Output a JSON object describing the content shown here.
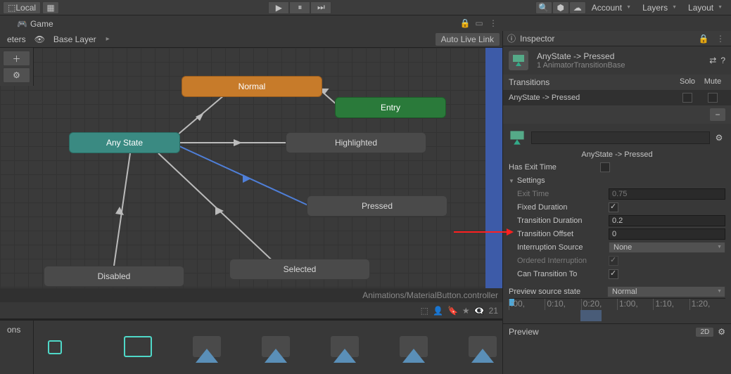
{
  "toolbar": {
    "local": "Local"
  },
  "dropdowns": {
    "account": "Account",
    "layers": "Layers",
    "layout": "Layout"
  },
  "tabs": {
    "game": "Game",
    "inspector": "Inspector"
  },
  "animator": {
    "left_tab_partial": "eters",
    "layer": "Base Layer",
    "autolink": "Auto Live Link",
    "footer": "Animations/MaterialButton.controller",
    "visible_count": "21"
  },
  "nodes": {
    "normal": "Normal",
    "entry": "Entry",
    "anystate": "Any State",
    "highlighted": "Highlighted",
    "pressed": "Pressed",
    "selected": "Selected",
    "disabled": "Disabled"
  },
  "inspector": {
    "title": "AnyState -> Pressed",
    "subtitle": "1 AnimatorTransitionBase",
    "transitions_header": "Transitions",
    "solo": "Solo",
    "mute": "Mute",
    "transition_item": "AnyState -> Pressed",
    "bar_label": "AnyState -> Pressed",
    "has_exit_time": "Has Exit Time",
    "settings": "Settings",
    "exit_time": "Exit Time",
    "exit_time_val": "0.75",
    "fixed_duration": "Fixed Duration",
    "transition_duration": "Transition Duration",
    "transition_duration_val": "0.2",
    "transition_offset": "Transition Offset",
    "transition_offset_val": "0",
    "interruption_source": "Interruption Source",
    "interruption_source_val": "None",
    "ordered_interruption": "Ordered Interruption",
    "can_transition_to": "Can Transition To ",
    "preview_source": "Preview source state",
    "preview_source_val": "Normal",
    "preview": "Preview"
  },
  "timeline": {
    "ticks": [
      ":00,",
      "0:10,",
      "0:20,",
      "1:00,",
      "1:10,",
      "1:20,"
    ]
  },
  "bottom": {
    "tab": "ons"
  },
  "chart_data": {
    "type": "graph",
    "nodes": [
      {
        "id": "Normal",
        "kind": "default-state",
        "color": "orange"
      },
      {
        "id": "Entry",
        "kind": "entry",
        "color": "green"
      },
      {
        "id": "Any State",
        "kind": "anystate",
        "color": "teal"
      },
      {
        "id": "Highlighted",
        "kind": "state",
        "color": "gray"
      },
      {
        "id": "Pressed",
        "kind": "state",
        "color": "gray"
      },
      {
        "id": "Selected",
        "kind": "state",
        "color": "gray"
      },
      {
        "id": "Disabled",
        "kind": "state",
        "color": "gray"
      }
    ],
    "transitions": [
      {
        "from": "Entry",
        "to": "Normal"
      },
      {
        "from": "Any State",
        "to": "Normal"
      },
      {
        "from": "Any State",
        "to": "Highlighted"
      },
      {
        "from": "Any State",
        "to": "Pressed",
        "selected": true
      },
      {
        "from": "Any State",
        "to": "Selected"
      },
      {
        "from": "Any State",
        "to": "Disabled"
      }
    ]
  }
}
